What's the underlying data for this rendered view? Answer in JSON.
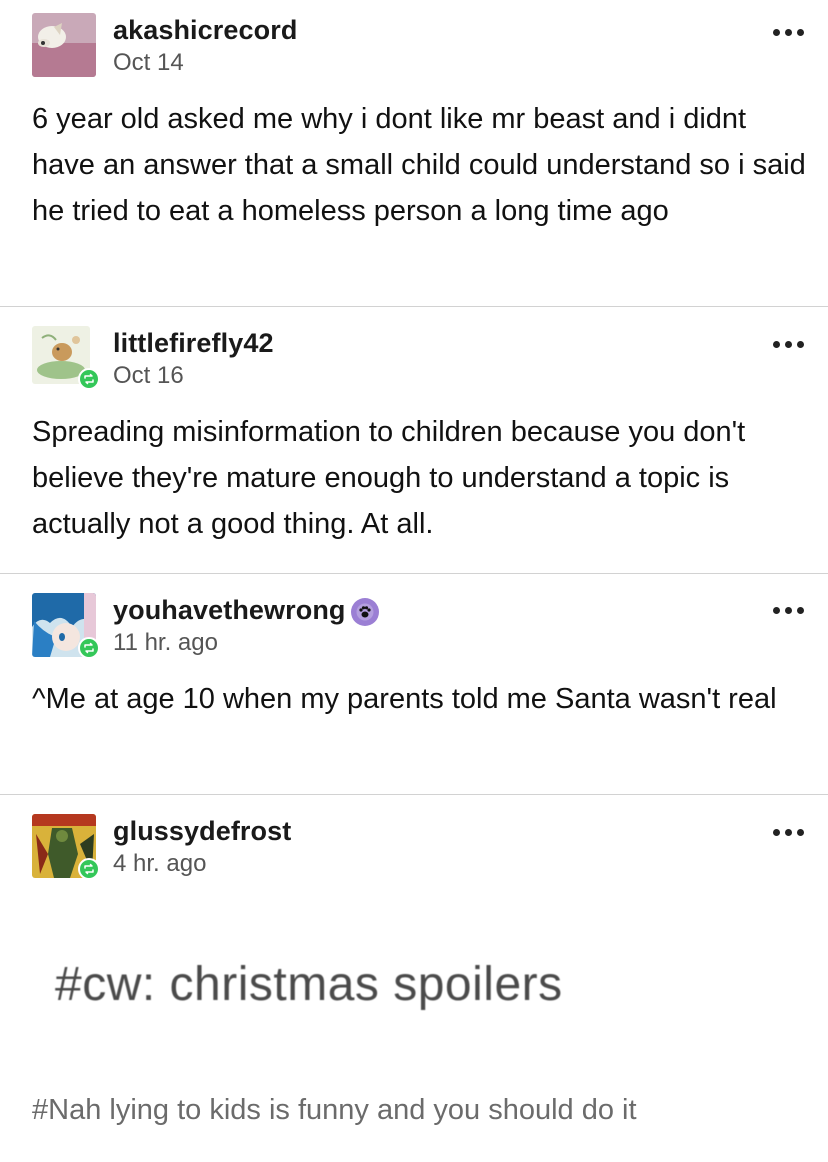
{
  "posts": [
    {
      "username": "akashicrecord",
      "time": "Oct 14",
      "text": "6 year old asked me why i dont like mr beast and i didnt have an answer that a small child could understand so i said he tried to eat a homeless person a long time ago"
    },
    {
      "username": "littlefirefly42",
      "time": "Oct 16",
      "text": "Spreading misinformation to children because you don't believe they're mature enough to understand a topic is actually not a good thing. At all."
    },
    {
      "username": "youhavethewrong",
      "time": "11 hr. ago",
      "text": "^Me at age 10 when my parents told me Santa wasn't real"
    },
    {
      "username": "glussydefrost",
      "time": "4 hr. ago",
      "spoiler": "#cw: christmas spoilers",
      "tag": "#Nah lying to kids is funny and you should do it"
    }
  ],
  "colors": {
    "reblog_badge": "#34c759",
    "separator": "#d2d2d2",
    "tag_text": "#6b6b6b"
  },
  "icons": {
    "reblog": "reblog-icon",
    "more": "more-options-icon",
    "paw": "paw-badge-icon"
  }
}
